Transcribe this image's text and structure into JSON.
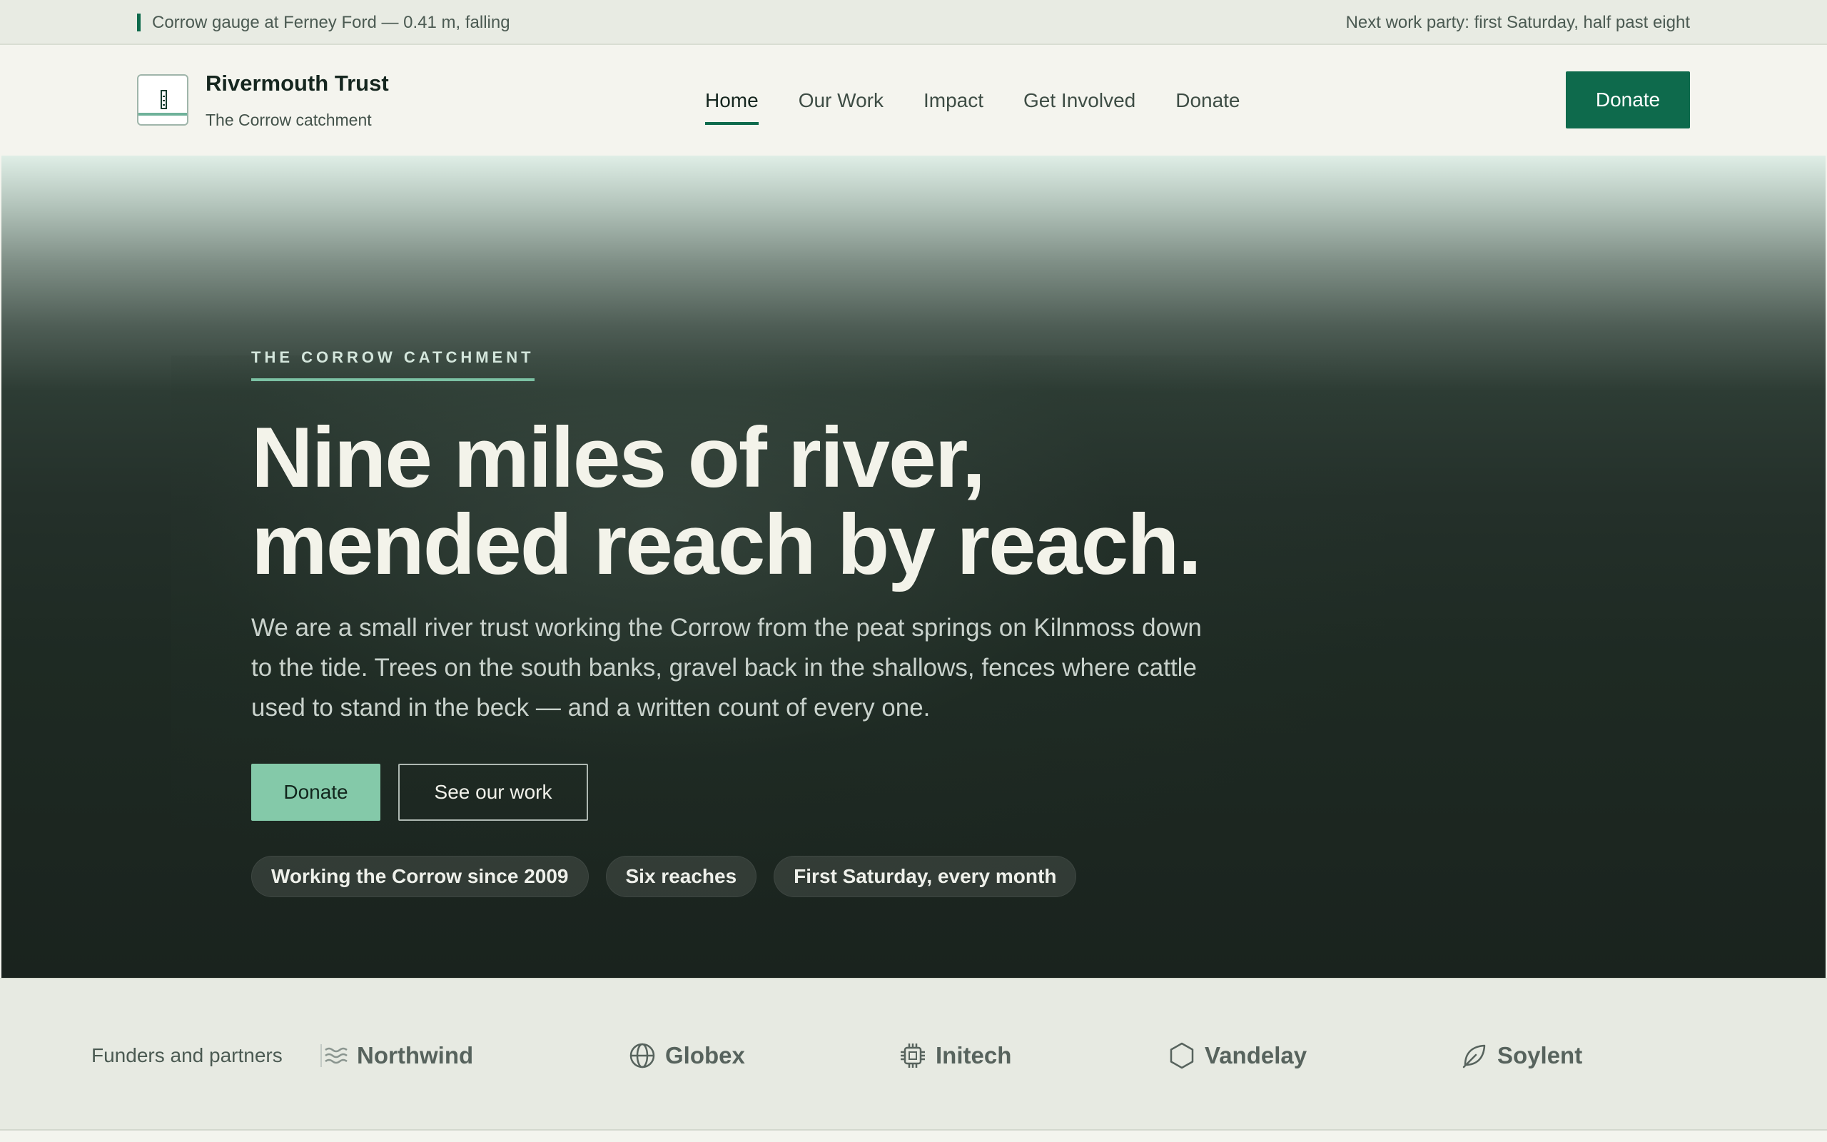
{
  "topbar": {
    "gauge_text": "Corrow gauge at Ferney Ford — 0.41 m, falling",
    "work_party_text": "Next work party: first Saturday, half past eight"
  },
  "brand": {
    "name": "Rivermouth Trust",
    "subtitle": "The Corrow catchment",
    "logo_icon": "river-gauge-icon"
  },
  "nav": {
    "items": [
      {
        "label": "Home",
        "active": true
      },
      {
        "label": "Our Work",
        "active": false
      },
      {
        "label": "Impact",
        "active": false
      },
      {
        "label": "Get Involved",
        "active": false
      },
      {
        "label": "Donate",
        "active": false
      }
    ],
    "cta_label": "Donate"
  },
  "hero": {
    "eyebrow": "THE CORROW CATCHMENT",
    "headline_line1": "Nine miles of river,",
    "headline_line2": "mended reach by reach.",
    "lede": "We are a small river trust working the Corrow from the peat springs on Kilnmoss down to the tide. Trees on the south banks, gravel back in the shallows, fences where cattle used to stand in the beck — and a written count of every one.",
    "primary_cta": "Donate",
    "secondary_cta": "See our work",
    "pills": [
      "Working the Corrow since 2009",
      "Six reaches",
      "First Saturday, every month"
    ]
  },
  "partners": {
    "label": "Funders and partners",
    "items": [
      {
        "name": "Northwind",
        "icon": "wind-waves-icon"
      },
      {
        "name": "Globex",
        "icon": "globe-icon"
      },
      {
        "name": "Initech",
        "icon": "chip-icon"
      },
      {
        "name": "Vandelay",
        "icon": "hexagon-icon"
      },
      {
        "name": "Soylent",
        "icon": "leaf-icon"
      }
    ]
  },
  "colors": {
    "accent": "#0e6a4c",
    "accent_light": "#84c9a9",
    "hero_dark": "#1a231e",
    "page_bg": "#f4f4ee"
  }
}
